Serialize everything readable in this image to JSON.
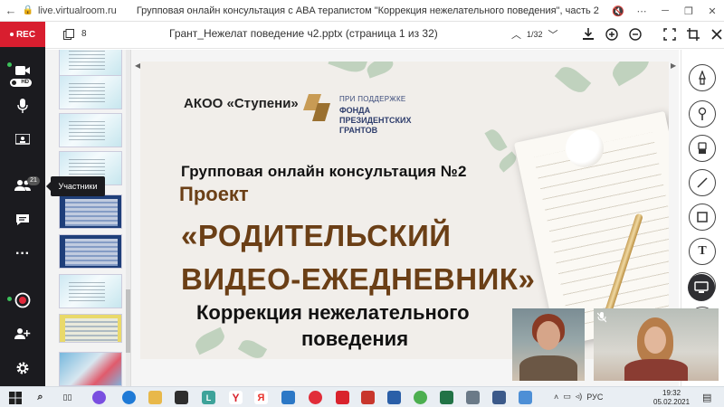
{
  "browser": {
    "url": "live.virtualroom.ru",
    "title": "Групповая онлайн консультация с ABA терапистом \"Коррекция нежелательного поведения\", часть 2"
  },
  "rail": {
    "rec_label": "REC",
    "hd_label": "HD",
    "participants_count": "21",
    "tooltip": "Участники"
  },
  "presentation": {
    "thumb_count": "8",
    "file_title": "Грант_Нежелат поведение ч2.pptx (страница 1 из 32)",
    "page_indicator": "1/32",
    "current_page": 1,
    "total_pages": 32
  },
  "slide": {
    "org": "АКОО «Ступени»",
    "fund_sub": "ПРИ ПОДДЕРЖКЕ",
    "fund_name": "ФОНДА ПРЕЗИДЕНТСКИХ ГРАНТОВ",
    "consultation": "Групповая онлайн консультация №2",
    "project": "Проект",
    "main_line1": "«РОДИТЕЛЬСКИЙ",
    "main_line2": "ВИДЕО-ЕЖЕДНЕВНИК»",
    "correction_line1": "Коррекция нежелательного",
    "correction_line2": "поведения"
  },
  "tools": [
    "brush-icon",
    "marker-icon",
    "eraser-icon",
    "line-icon",
    "rectangle-icon",
    "text-icon",
    "stamp-icon"
  ],
  "text_tool_label": "T",
  "taskbar": {
    "lang": "РУС",
    "time": "19:32",
    "date": "05.02.2021"
  },
  "colors": {
    "rail": "#1b1b1f",
    "rec": "#d81e2f",
    "brown_title": "#6b3f16"
  }
}
